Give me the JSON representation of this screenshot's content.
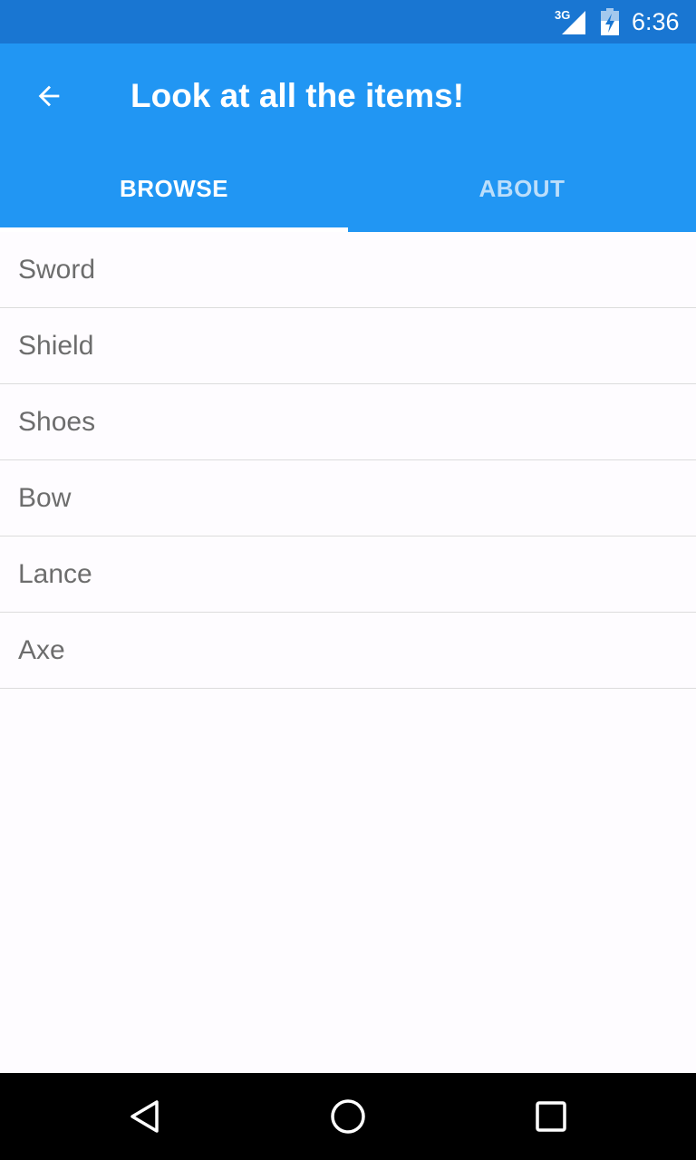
{
  "status_bar": {
    "network": "3G",
    "time": "6:36",
    "icons": [
      "signal-icon",
      "battery-icon"
    ]
  },
  "app_bar": {
    "back_icon": "arrow-back-icon",
    "title": "Look at all the items!",
    "color": "#2196f3"
  },
  "tabs": [
    {
      "label": "BROWSE",
      "selected": true
    },
    {
      "label": "ABOUT",
      "selected": false
    }
  ],
  "items": [
    {
      "label": "Sword"
    },
    {
      "label": "Shield"
    },
    {
      "label": "Shoes"
    },
    {
      "label": "Bow"
    },
    {
      "label": "Lance"
    },
    {
      "label": "Axe"
    }
  ],
  "nav_bar": {
    "icons": [
      "back-triangle-icon",
      "home-circle-icon",
      "recents-square-icon"
    ]
  },
  "colors": {
    "status_bar": "#1976d2",
    "primary": "#2196f3",
    "background": "#fefcff",
    "item_text": "#6d6d6d"
  }
}
